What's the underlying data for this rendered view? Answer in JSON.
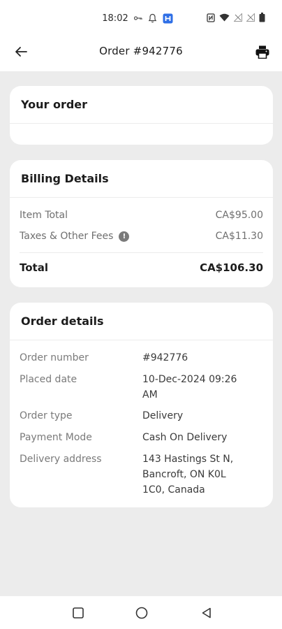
{
  "status_bar": {
    "time": "18:02",
    "icons": [
      "key-icon",
      "bell-icon",
      "app-h-icon",
      "nfc-icon",
      "wifi-icon",
      "signal-icon",
      "signal-icon",
      "battery-icon"
    ]
  },
  "header": {
    "title": "Order #942776",
    "back_icon": "arrow-left-icon",
    "print_icon": "printer-icon"
  },
  "your_order": {
    "title": "Your order"
  },
  "billing": {
    "title": "Billing Details",
    "item_total_label": "Item Total",
    "item_total_value": "CA$95.00",
    "taxes_label": "Taxes & Other Fees",
    "taxes_info_icon": "info-icon",
    "taxes_value": "CA$11.30",
    "total_label": "Total",
    "total_value": "CA$106.30"
  },
  "order_details": {
    "title": "Order details",
    "rows": [
      {
        "label": "Order number",
        "value": "#942776"
      },
      {
        "label": "Placed date",
        "value": "10-Dec-2024 09:26 AM"
      },
      {
        "label": "Order type",
        "value": "Delivery"
      },
      {
        "label": "Payment Mode",
        "value": "Cash On Delivery"
      },
      {
        "label": "Delivery address",
        "value": "143 Hastings St N, Bancroft, ON K0L 1C0, Canada"
      }
    ]
  },
  "nav": {
    "recents_icon": "square-icon",
    "home_icon": "circle-icon",
    "back_icon": "triangle-back-icon"
  },
  "colors": {
    "background": "#ececec",
    "card": "#ffffff",
    "text_primary": "#1c1c1c",
    "text_secondary": "#6f6f6f",
    "accent_status_icon": "#2f6fe6"
  }
}
